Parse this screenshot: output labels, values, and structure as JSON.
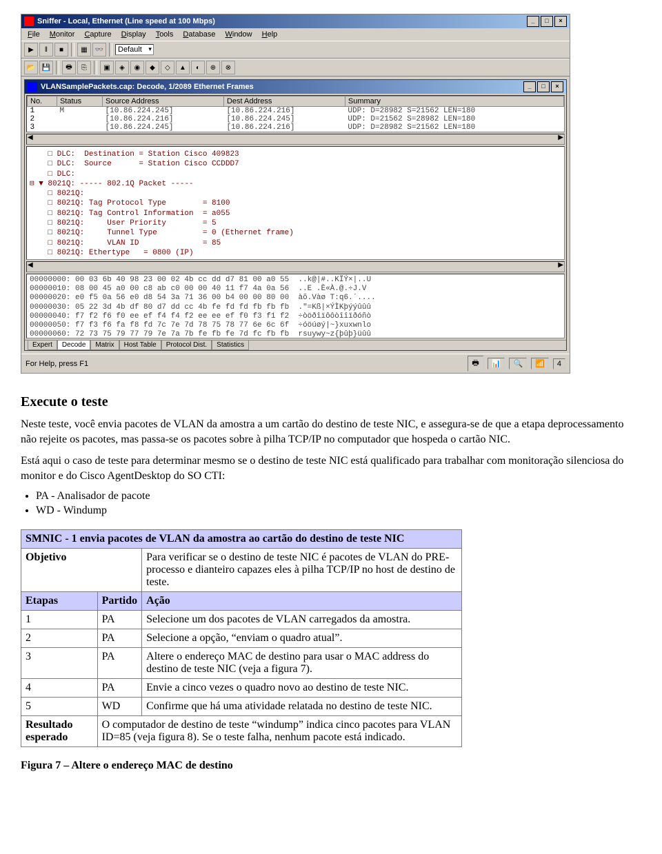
{
  "sniffer": {
    "title": "Sniffer - Local, Ethernet (Line speed at 100 Mbps)",
    "menu": [
      "File",
      "Monitor",
      "Capture",
      "Display",
      "Tools",
      "Database",
      "Window",
      "Help"
    ],
    "dropdown_value": "Default",
    "subwin_title": "VLANSamplePackets.cap: Decode, 1/2089 Ethernet Frames",
    "columns": [
      "No.",
      "Status",
      "Source Address",
      "Dest Address",
      "Summary"
    ],
    "rows": [
      {
        "no": "1",
        "status": "M",
        "src": "[10.86.224.245]",
        "dst": "[10.86.224.216]",
        "summary": "UDP: D=28982 S=21562   LEN=180"
      },
      {
        "no": "2",
        "status": "",
        "src": "[10.86.224.216]",
        "dst": "[10.86.224.245]",
        "summary": "UDP: D=21562 S=28982   LEN=180"
      },
      {
        "no": "3",
        "status": "",
        "src": "[10.86.224.245]",
        "dst": "[10.86.224.216]",
        "summary": "UDP: D=28982 S=21562   LEN=180"
      }
    ],
    "decode_lines": [
      "    □ DLC:  Destination = Station Cisco 409823",
      "    □ DLC:  Source      = Station Cisco CCDDD7",
      "    □ DLC:",
      "⊟ ▼ 8021Q: ----- 802.1Q Packet -----",
      "    □ 8021Q:",
      "    □ 8021Q: Tag Protocol Type        = 8100",
      "    □ 8021Q: Tag Control Information  = a055",
      "    □ 8021Q:     User Priority        = 5",
      "    □ 8021Q:     Tunnel Type          = 0 (Ethernet frame)",
      "    □ 8021Q:     VLAN ID              = 85",
      "    □ 8021Q: Ethertype   = 0800 (IP)"
    ],
    "hex_lines": [
      "00000000: 00 03 6b 40 98 23 00 02 4b cc dd d7 81 00 a0 55  ..k@|#..KÏÝ×|..U",
      "00000010: 08 00 45 a0 00 c8 ab c0 00 00 40 11 f7 4a 0a 56  ..E .È«À.@.÷J.V",
      "00000020: e0 f5 0a 56 e0 d8 54 3a 71 36 00 b4 00 00 80 00  àõ.Vàø T:q6.´....",
      "00000030: 05 22 3d 4b df 80 d7 dd cc 4b fe fd fd fb fb fb  .\"=Kß|×ÝÌKþýýûûû",
      "00000040: f7 f2 f6 f0 ee ef f4 f4 f2 ee ee ef f0 f3 f1 f2  ÷òöðîïôôòîîïðóñò",
      "00000050: f7 f3 f6 fa f8 fd 7c 7e 7d 78 75 78 77 6e 6c 6f  ÷óöúøý|~}xuxwnlo",
      "00000060: 72 73 75 79 77 79 7e 7a 7b fe fb fe 7d fc fb fb  rsuywy~z{þûþ}üûû"
    ],
    "tabs": [
      "Expert",
      "Decode",
      "Matrix",
      "Host Table",
      "Protocol Dist.",
      "Statistics"
    ],
    "active_tab": "Decode",
    "status_text": "For Help, press F1",
    "status_page": "4"
  },
  "doc": {
    "heading": "Execute o teste",
    "para1": "Neste teste, você envia pacotes de VLAN da amostra a um cartão do destino de teste NIC, e assegura-se de que a etapa deprocessamento não rejeite os pacotes, mas passa-se os pacotes sobre à pilha TCP/IP no computador que hospeda o cartão NIC.",
    "para2": "Está aqui o caso de teste para determinar mesmo se o destino de teste NIC está qualificado para trabalhar com monitoração silenciosa do monitor e do Cisco AgentDesktop do SO CTI:",
    "bullets": [
      "PA - Analisador de pacote",
      "WD - Windump"
    ],
    "table": {
      "title": "SMNIC - 1 envia pacotes de VLAN da amostra ao cartão do destino de teste NIC",
      "objective_label": "Objetivo",
      "objective_text": "Para verificar se o destino de teste NIC é pacotes de VLAN do PRE-processo e dianteiro capazes eles à pilha TCP/IP no host de destino de teste.",
      "col_steps": "Etapas",
      "col_party": "Partido",
      "col_action": "Ação",
      "steps": [
        {
          "n": "1",
          "party": "PA",
          "action": "Selecione um dos pacotes de VLAN carregados da amostra."
        },
        {
          "n": "2",
          "party": "PA",
          "action": "Selecione a opção, “enviam o quadro atual”."
        },
        {
          "n": "3",
          "party": "PA",
          "action": "Altere o endereço MAC de destino para usar o MAC address do destino de teste NIC (veja a figura 7)."
        },
        {
          "n": "4",
          "party": "PA",
          "action": "Envie a cinco vezes o quadro novo ao destino de teste NIC."
        },
        {
          "n": "5",
          "party": "WD",
          "action": "Confirme que há uma atividade relatada no destino de teste NIC."
        }
      ],
      "result_label": "Resultado esperado",
      "result_text": "O computador de destino de teste “windump” indica cinco pacotes para VLAN ID=85 (veja figura 8). Se o teste falha, nenhum pacote está indicado."
    },
    "figure_caption": "Figura 7 – Altere o endereço MAC de destino"
  }
}
